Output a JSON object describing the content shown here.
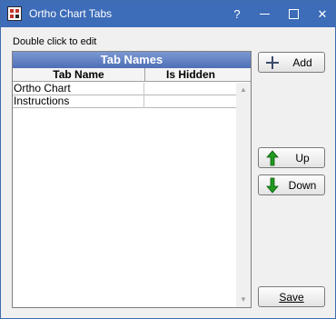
{
  "window": {
    "title": "Ortho Chart Tabs"
  },
  "titlebar": {
    "help": "?",
    "close": "✕"
  },
  "hint": "Double click to edit",
  "grid": {
    "title": "Tab Names",
    "columns": [
      "Tab Name",
      "Is Hidden"
    ],
    "rows": [
      {
        "name": "Ortho Chart",
        "hidden": ""
      },
      {
        "name": "Instructions",
        "hidden": ""
      }
    ]
  },
  "buttons": {
    "add": "Add",
    "up": "Up",
    "down": "Down",
    "save": "Save"
  },
  "icons": {
    "app": "grid-app-icon",
    "add": "plus-icon",
    "up": "green-up-arrow-icon",
    "down": "green-down-arrow-icon"
  },
  "colors": {
    "titlebar": "#3d6cb8",
    "grid_title": "#5d7dc0",
    "arrow_green": "#1f9a1f"
  }
}
